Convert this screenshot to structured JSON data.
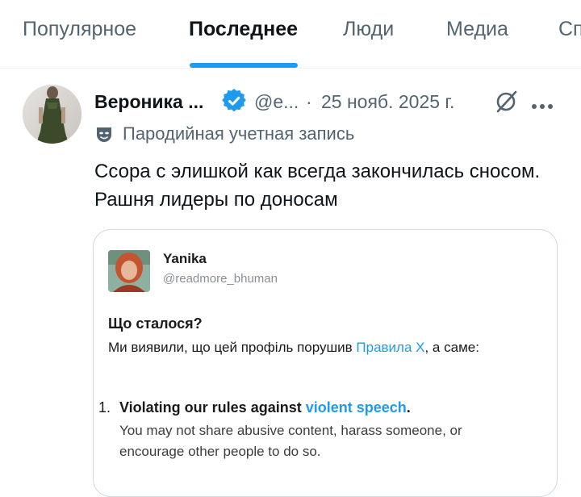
{
  "tabs": [
    {
      "label": "Популярное"
    },
    {
      "label": "Последнее"
    },
    {
      "label": "Люди"
    },
    {
      "label": "Медиа"
    },
    {
      "label": "Сп"
    }
  ],
  "active_tab": "Последнее",
  "tweet": {
    "author_name": "Вероника ...",
    "handle": "@e...",
    "separator": "·",
    "date": "25 нояб. 2025 г.",
    "parody_label": "Пародийная учетная запись",
    "text": "Ссора с элишкой как всегда закончилась сносом. Рашня лидеры по доносам"
  },
  "media_card": {
    "name": "Yanika",
    "handle": "@readmore_bhuman",
    "heading": "Що сталося?",
    "line_prefix": "Ми виявили, що цей профіль порушив ",
    "line_link": "Правила X",
    "line_suffix": ", а саме:",
    "rule_number": "1.",
    "rule_title_prefix": "Violating our rules against ",
    "rule_title_link": "violent speech",
    "rule_title_suffix": ".",
    "rule_description": "You may not share abusive content, harass someone, or encourage other people to do so."
  },
  "colors": {
    "accent": "#1d9bf0",
    "text": "#0f1419",
    "muted": "#536471",
    "border": "#cfd9de"
  },
  "icons": [
    "verified-badge-icon",
    "grok-icon",
    "more-icon",
    "parody-mask-icon"
  ]
}
